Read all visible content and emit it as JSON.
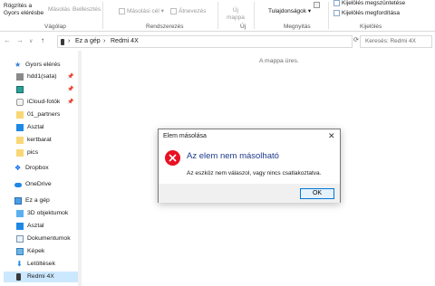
{
  "ribbon": {
    "rogzites_line1": "Rögzítés a",
    "rogzites_line2": "Gyors elérésbe",
    "masolas": "Másolás",
    "beillesztes": "Beillesztés",
    "masolasi_cel": "Másolási cél",
    "atnevezes": "Átnevezés",
    "uj_mappa_line1": "Új",
    "uj_mappa_line2": "mappa",
    "tulajdonsagok": "Tulajdonságok",
    "kijeloles_megszuntetese": "Kijelölés megszüntetése",
    "kijeloles_megforditasa": "Kijelölés megfordítása",
    "group_vagolap": "Vágólap",
    "group_rendszerezes": "Rendszerezés",
    "group_uj": "Új",
    "group_megnyitas": "Megnyitás",
    "group_kijeloles": "Kijelölés"
  },
  "address": {
    "separator1": "›",
    "crumb1": "Ez a gép",
    "separator2": "›",
    "crumb2": "Redmi 4X",
    "search_placeholder": "Keresés: Redmi 4X"
  },
  "nav": {
    "back": "←",
    "forward": "→",
    "up": "↑",
    "dropdown": "∨",
    "items": [
      {
        "label": "Gyors elérés",
        "icon": "star-icon"
      },
      {
        "label": "hdd1(sata)",
        "icon": "drive-icon"
      },
      {
        "label": "",
        "icon": "green-drive-icon"
      },
      {
        "label": "iCloud-fotók",
        "icon": "icloud-icon"
      },
      {
        "label": "01_partners",
        "icon": "folder-icon"
      },
      {
        "label": "Asztal",
        "icon": "desktop-icon"
      },
      {
        "label": "kertbarat",
        "icon": "folder-icon"
      },
      {
        "label": "pics",
        "icon": "folder-icon"
      },
      {
        "label": "Dropbox",
        "icon": "dropbox-icon"
      },
      {
        "label": "OneDrive",
        "icon": "onedrive-icon"
      },
      {
        "label": "Ez a gép",
        "icon": "computer-icon"
      },
      {
        "label": "3D objektumok",
        "icon": "3d-objects-icon"
      },
      {
        "label": "Asztal",
        "icon": "desktop-icon"
      },
      {
        "label": "Dokumentumok",
        "icon": "documents-icon"
      },
      {
        "label": "Képek",
        "icon": "pictures-icon"
      },
      {
        "label": "Letöltések",
        "icon": "downloads-icon"
      },
      {
        "label": "Redmi 4X",
        "icon": "phone-icon"
      }
    ]
  },
  "content": {
    "empty_message": "A mappa üres."
  },
  "dialog": {
    "title": "Elem másolása",
    "close": "✕",
    "heading": "Az elem nem másolható",
    "message": "Az eszköz nem válaszol, vagy nincs csatlakoztatva.",
    "ok_label": "OK"
  },
  "colors": {
    "accent": "#0078d7",
    "selection": "#cce8ff",
    "error": "#e81123",
    "heading_blue": "#1e3a8a",
    "folder_yellow": "#f8d775"
  }
}
